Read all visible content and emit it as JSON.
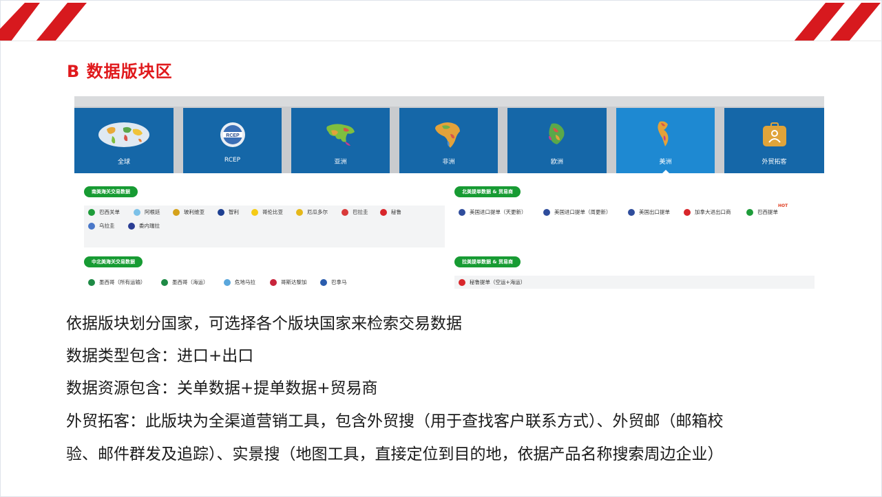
{
  "section_title": "B 数据版块区",
  "tiles": [
    {
      "label": "全球",
      "icon": "globe-map-icon"
    },
    {
      "label": "RCEP",
      "icon": "rcep-globe-icon"
    },
    {
      "label": "亚洲",
      "icon": "asia-map-icon"
    },
    {
      "label": "非洲",
      "icon": "africa-map-icon"
    },
    {
      "label": "欧洲",
      "icon": "europe-map-icon"
    },
    {
      "label": "美洲",
      "icon": "americas-map-icon",
      "active": true
    },
    {
      "label": "外贸拓客",
      "icon": "briefcase-user-icon"
    }
  ],
  "groups": {
    "south_customs": {
      "title": "南美海关交易数据",
      "items": [
        "巴西关单",
        "阿根廷",
        "玻利维亚",
        "智利",
        "哥伦比亚",
        "厄瓜多尔",
        "巴拉圭",
        "秘鲁",
        "乌拉圭",
        "委内瑞拉"
      ]
    },
    "north_bl": {
      "title": "北美提单数据 & 贸易商",
      "items": [
        "美国进口提单（天更新）",
        "美国进口提单（周更新）",
        "美国出口提单",
        "加拿大进出口商",
        "巴西提单"
      ],
      "hot_label": "HOT"
    },
    "central_customs": {
      "title": "中北美海关交易数据",
      "items": [
        "墨西哥（所有运输）",
        "墨西哥（海运）",
        "危地马拉",
        "哥斯达黎加",
        "巴拿马"
      ]
    },
    "latin_bl": {
      "title": "拉美提单数据 & 贸易商",
      "items": [
        "秘鲁提单（空运+海运）"
      ]
    }
  },
  "flag_colors": {
    "brazil": "#1e9c3a",
    "argentina": "#7cc1e8",
    "bolivia": "#d5a21b",
    "chile": "#1d3f91",
    "colombia": "#f5cb16",
    "ecuador": "#e5b81a",
    "paraguay": "#d93a3a",
    "peru": "#d8262b",
    "uruguay": "#4a78c9",
    "venezuela": "#2a3d94",
    "usa": "#2f4d9c",
    "canada": "#d8262b",
    "mexico": "#1e8a45",
    "guatemala": "#5aa7dc",
    "costa_rica": "#c8243b",
    "panama": "#2a5cad"
  },
  "accent_color": "#e0191c",
  "tile_color": "#1567a8",
  "tile_active_color": "#1e89d2",
  "badge_color": "#179b33",
  "paragraphs": [
    "依据版块划分国家，可选择各个版块国家来检索交易数据",
    "数据类型包含：进口+出口",
    "数据资源包含：关单数据+提单数据+贸易商",
    "外贸拓客：此版块为全渠道营销工具，包含外贸搜（用于查找客户联系方式）、外贸邮（邮箱校",
    "验、邮件群发及追踪）、实景搜（地图工具，直接定位到目的地，依据产品名称搜索周边企业）"
  ]
}
